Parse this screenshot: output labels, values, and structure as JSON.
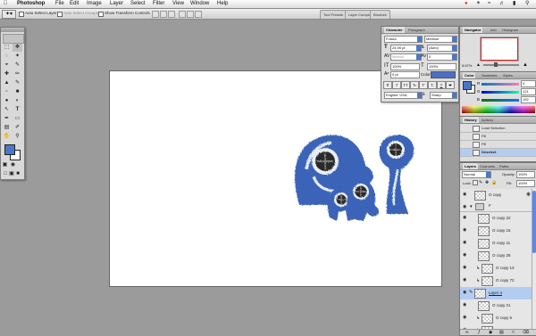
{
  "menubar": {
    "app": "Photoshop",
    "items": [
      "File",
      "Edit",
      "Image",
      "Layer",
      "Select",
      "Filter",
      "View",
      "Window",
      "Help"
    ]
  },
  "options": {
    "auto_select_layer": "Auto Select Layer",
    "auto_select_groups": "Auto Select Groups",
    "show_transform": "Show Transform Controls",
    "well_tabs": [
      "Tool Presets",
      "Layer Comps",
      "Brushes"
    ]
  },
  "character": {
    "tabs": [
      "Character",
      "Paragraph"
    ],
    "font_family": "Futura",
    "font_style": "Medium",
    "font_size": "24.95 pt",
    "leading": "(Auto)",
    "kerning": "Metrics",
    "tracking": "0",
    "vscale": "100%",
    "hscale": "100%",
    "baseline": "0 pt",
    "color_label": "Color:",
    "style_buttons": [
      "T",
      "T",
      "TT",
      "Tr",
      "T'",
      "T,",
      "T",
      "T"
    ],
    "language": "English: USA",
    "antialias": "Sharp",
    "color": "#4a6fc4"
  },
  "navigator": {
    "tabs": [
      "Navigator",
      "Info",
      "Histogram"
    ],
    "zoom": "8.67%"
  },
  "colorpanel": {
    "tabs": [
      "Color",
      "Swatches",
      "Styles"
    ],
    "channels": [
      {
        "label": "R",
        "value": "0"
      },
      {
        "label": "G",
        "value": "121"
      },
      {
        "label": "B",
        "value": "192"
      }
    ],
    "foreground": "#4a78c8"
  },
  "history": {
    "tabs": [
      "History",
      "Actions"
    ],
    "items": [
      "Load Selection",
      "Fill",
      "Fill",
      "Deselect"
    ]
  },
  "layers": {
    "tabs": [
      "Layers",
      "Channels",
      "Paths"
    ],
    "blend_mode": "Normal",
    "opacity_label": "Opacity:",
    "opacity": "100%",
    "lock_label": "Lock:",
    "fill_label": "Fill:",
    "fill": "100%",
    "rows": [
      {
        "name": "O copy",
        "selected": false,
        "indent": 0
      },
      {
        "name": "F",
        "selected": false,
        "indent": 0
      },
      {
        "name": "O copy 22",
        "selected": false,
        "indent": 1
      },
      {
        "name": "O copy 15",
        "selected": false,
        "indent": 1
      },
      {
        "name": "O copy 11",
        "selected": false,
        "indent": 1
      },
      {
        "name": "O copy 26",
        "selected": false,
        "indent": 1
      },
      {
        "name": "O copy 13",
        "selected": false,
        "indent": 2
      },
      {
        "name": "O copy 72",
        "selected": false,
        "indent": 2
      },
      {
        "name": "Layer 4",
        "selected": true,
        "indent": 0
      },
      {
        "name": "O copy 21",
        "selected": false,
        "indent": 1
      },
      {
        "name": "O copy 5",
        "selected": false,
        "indent": 2
      },
      {
        "name": "O copy 4",
        "selected": false,
        "indent": 2
      }
    ]
  },
  "tools": [
    "⬚",
    "✥",
    "◌",
    "✂",
    "⌖",
    "✎",
    "⌫",
    "▲",
    "◐",
    "⬤",
    "T",
    "↖",
    "▭",
    "✋",
    "🔍"
  ]
}
